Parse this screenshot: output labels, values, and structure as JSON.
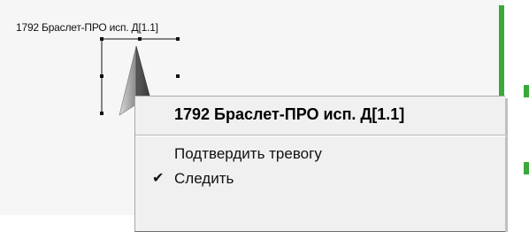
{
  "map": {
    "device_label": "1792 Браслет-ПРО исп. Д[1.1]",
    "marker_icon": "arrow-pointer-marker-icon",
    "line_color": "#3aa83a"
  },
  "context_menu": {
    "header": "1792 Браслет-ПРО исп. Д[1.1]",
    "items": [
      {
        "label": "Подтвердить тревогу",
        "checked": false
      },
      {
        "label": "Следить",
        "checked": true,
        "check_icon": "✔"
      }
    ]
  }
}
